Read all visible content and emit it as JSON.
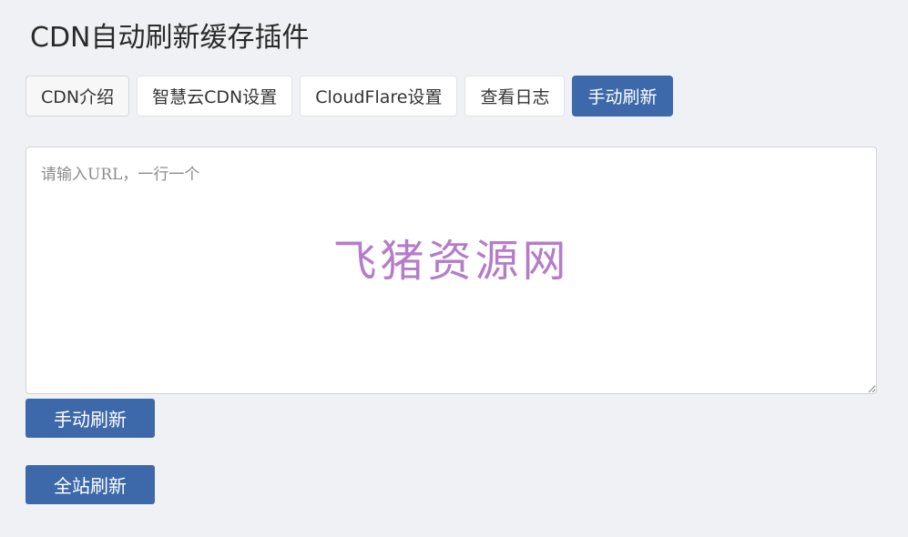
{
  "page": {
    "title": "CDN自动刷新缓存插件"
  },
  "tabs": [
    {
      "label": "CDN介绍",
      "state": "default"
    },
    {
      "label": "智慧云CDN设置",
      "state": "default"
    },
    {
      "label": "CloudFlare设置",
      "state": "default"
    },
    {
      "label": "查看日志",
      "state": "default"
    },
    {
      "label": "手动刷新",
      "state": "active"
    }
  ],
  "url_input": {
    "placeholder": "请输入URL，一行一个",
    "value": ""
  },
  "watermark": {
    "text": "飞猪资源网"
  },
  "buttons": {
    "manual_refresh": "手动刷新",
    "full_site_refresh": "全站刷新"
  },
  "colors": {
    "accent": "#3d69aa",
    "background": "#f0f1f4",
    "watermark": "#b57cc9"
  }
}
